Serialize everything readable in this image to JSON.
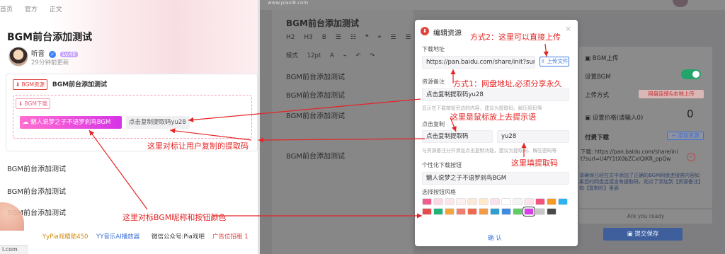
{
  "left": {
    "nav": [
      "首页",
      "官方",
      "正文"
    ],
    "post_title": "BGM前台添加测试",
    "author": {
      "name": "听音",
      "level_badge": "Lv.40"
    },
    "time": "29分钟前更新",
    "resource": {
      "tag": "BGM资源",
      "title": "BGM前台添加测试",
      "download_tag": "BGM下载",
      "bgm_button": "魑人说梦之子不语罗刹鸟BGM",
      "copy_button": "点击复制提取码yu28"
    },
    "paragraphs": [
      "BGM前台添加测试",
      "BGM前台添加测试",
      "BGM前台添加测试"
    ],
    "bottom_links": [
      "YyPia戏精助450",
      "YY音乐AI播放器",
      "微信公众号:Pia戏吧",
      "广告位招租 1"
    ],
    "status_url": "l.com"
  },
  "editor": {
    "site": "www.piaxi8.com",
    "title": "BGM前台添加测试",
    "toolbar1": [
      "H2",
      "H3",
      "B",
      "☰",
      "☷",
      "❝",
      "⌖",
      "☰",
      "☰",
      "≡"
    ],
    "toolbar2": [
      "模式",
      "12pt",
      "A",
      "⌁",
      "↶",
      "↷"
    ],
    "paragraphs": [
      "BGM前台添加测试",
      "BGM前台添加测试",
      "BGM前台添加测试",
      "BGM前台添加测试"
    ]
  },
  "side": {
    "section": "BGM上传",
    "setting_label": "设置BGM",
    "upload_label": "上传方式",
    "mode_value": "网盘连接&本地上传",
    "price_label": "设置价格(请输入0)",
    "price_value": "0",
    "paid_label": "付费下载",
    "add_resource": "+ 添加资源",
    "link_text": "下载: https://pan.baidu.com/share/init?surl=U4fY1tX0bZCxIQlKR_ppQw",
    "note": "请确保已经在文中添加了正确的BGM网盘连接需内容如果您的网盘连接含有提取码，则点了添加到【资源备注】和【复制栏】里面",
    "ready": "Are you ready",
    "save": "提交保存"
  },
  "dialog": {
    "title": "编辑资源",
    "close": "×",
    "download_label": "下载地址",
    "download_value": "https://pan.baidu.com/share/init?surl=U",
    "upload_button": "上传文件",
    "note_label": "资源备注",
    "note_value": "点击复制提取码yu28",
    "note_hint": "显示在下载按钮旁边的内容，建议为提取码、解压密码等",
    "copy_label": "点击复制",
    "copy_left": "点击复制提取码",
    "copy_right": "yu28",
    "copy_hint": "与资源备注分开添加点击复制功能，建议为提取码、解压密码等",
    "button_label": "个性化下载按钮",
    "button_value": "魑人说梦之子不语罗刹鸟BGM",
    "style_label": "选择按钮风格",
    "swatches_row1": [
      "#f05f8b",
      "#fbd7e2",
      "#fde6ea",
      "#fff0f0",
      "#fbe9d7",
      "#ffe9c7",
      "#fbe0ee",
      "#ffffff",
      "#f4f4f5",
      "#fde3ea",
      "#f2537a",
      "#f59a23",
      "#2eb2f0"
    ],
    "swatches_row2": [
      "#e84b4b",
      "#22b37a",
      "#f4a43c",
      "#f07f6f",
      "#ef6a4c",
      "#f59a45",
      "#2e9fcf",
      "#3e8be0",
      "#60cc66",
      "#d93ee8",
      "#c7c7c7",
      "#4a4a4a"
    ],
    "confirm": "确 认"
  },
  "annotations": {
    "a1": "方式2：这里可以直接上传",
    "a2": "方式1：网盘地址,必须分享永久",
    "a3": "这里是鼠标放上去提示语",
    "a4": "这里对标让用户复制的提取码",
    "a5": "这里填提取码",
    "a6": "这里对标BGM昵称和按钮颜色"
  },
  "colors": {
    "accent_red": "#e52424",
    "primary_blue": "#3c7be3",
    "bgm_button_from": "#ff6fcf",
    "bgm_button_to": "#d633e6"
  }
}
